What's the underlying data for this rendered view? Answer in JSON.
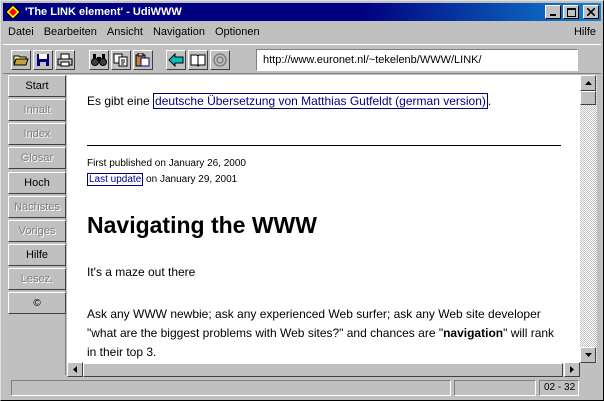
{
  "window": {
    "title": "'The LINK element' - UdiWWW"
  },
  "menu": {
    "items": [
      "Datei",
      "Bearbeiten",
      "Ansicht",
      "Navigation",
      "Optionen"
    ],
    "help": "Hilfe"
  },
  "toolbar": {
    "icons": [
      "open-folder-icon",
      "save-icon",
      "print-icon",
      "find-icon",
      "copy-icon",
      "paste-icon",
      "back-arrow-icon",
      "bookmark-book-icon",
      "stop-icon"
    ],
    "url": "http://www.euronet.nl/~tekelenb/WWW/LINK/"
  },
  "sidebar": {
    "buttons": [
      {
        "label": "Start",
        "enabled": true
      },
      {
        "label": "Inhalt",
        "enabled": false
      },
      {
        "label": "Index",
        "enabled": false
      },
      {
        "label": "Glosar",
        "enabled": false
      },
      {
        "label": "Hoch",
        "enabled": true
      },
      {
        "label": "Nächstes",
        "enabled": false
      },
      {
        "label": "Voriges",
        "enabled": false
      },
      {
        "label": "Hilfe",
        "enabled": true
      },
      {
        "label": "Lesez.",
        "enabled": false
      },
      {
        "label": "©",
        "enabled": true
      }
    ]
  },
  "content": {
    "translation_prefix": "Es gibt eine ",
    "translation_link": "deutsche Übersetzung von Matthias Gutfeldt (german version)",
    "translation_suffix": ".",
    "first_published": "First published on January 26, 2000",
    "last_update_link": "Last update",
    "last_update_rest": " on January 29, 2001",
    "heading": "Navigating the WWW",
    "maze": "It's a maze out there",
    "para_1": "Ask any WWW newbie; ask any experienced Web surfer; ask any Web site developer \"what are the biggest problems with Web sites?\" and chances are \"",
    "para_bold": "navigation",
    "para_2": "\" will rank in their top 3."
  },
  "status": {
    "text": "",
    "progress": "",
    "position": "02 - 32"
  },
  "colors": {
    "title_active": "#000080",
    "link": "#000080",
    "face": "#c0c0c0"
  }
}
